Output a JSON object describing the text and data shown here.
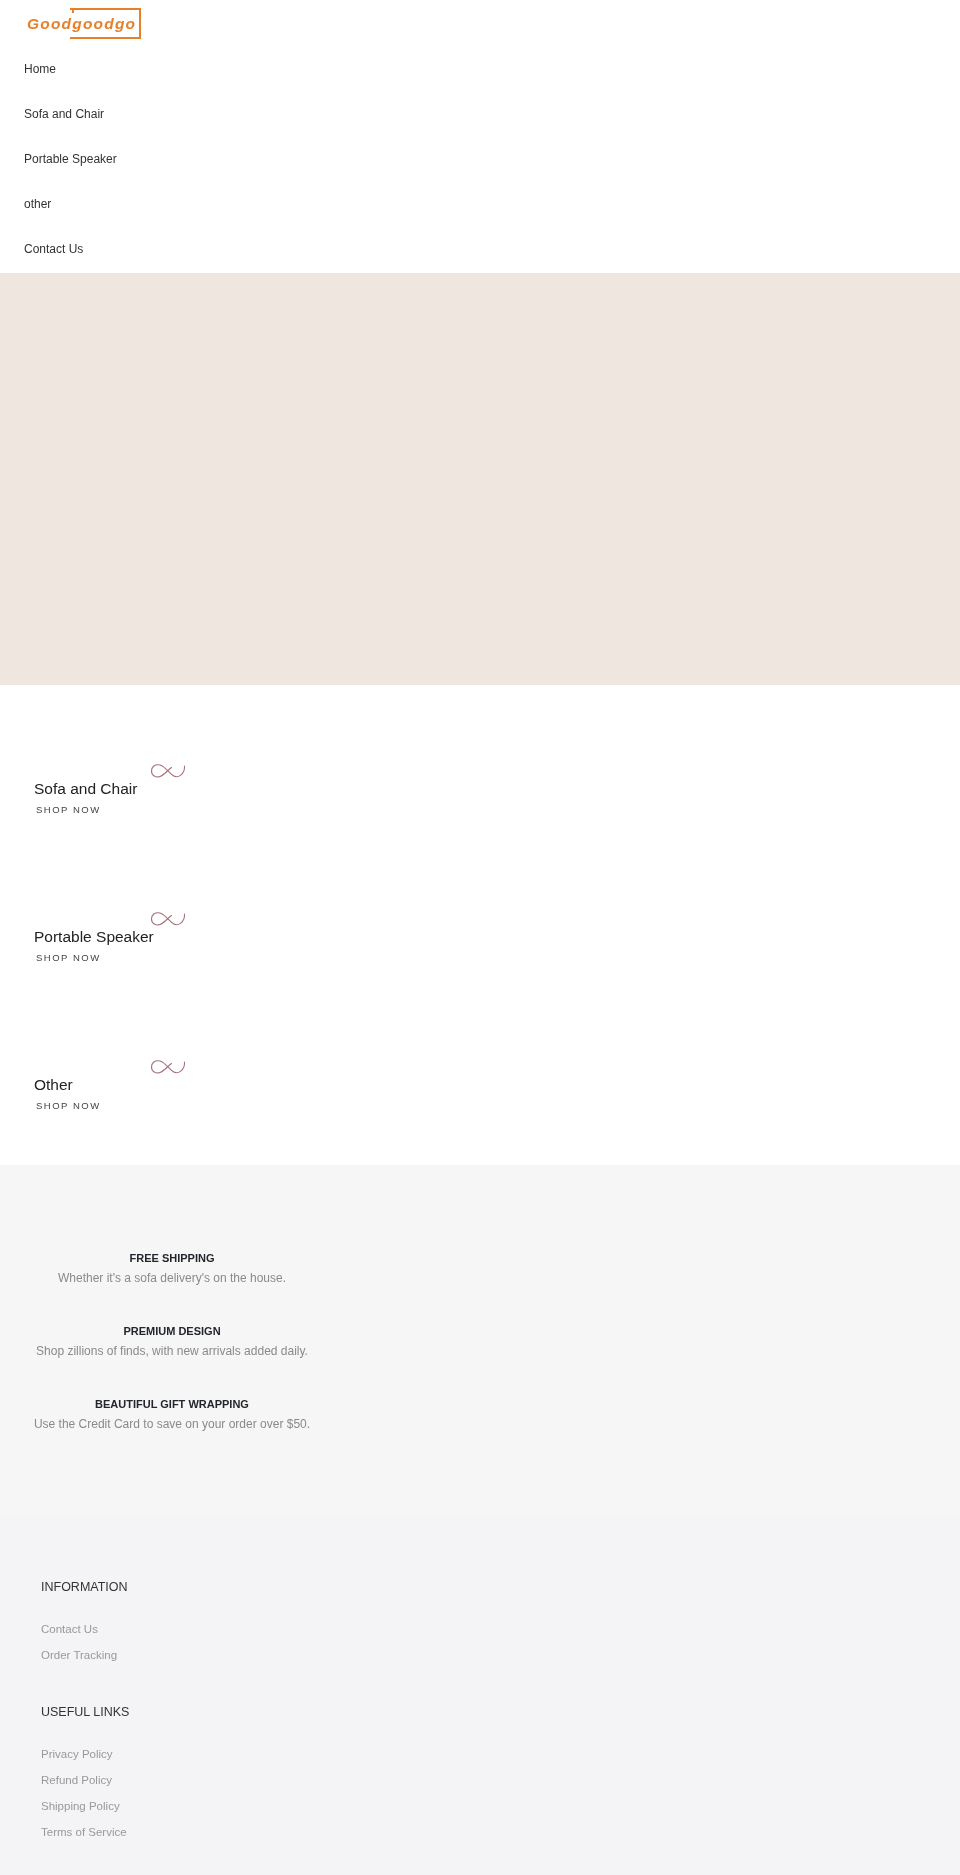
{
  "header": {
    "logo": "Goodgoodgo",
    "nav": [
      "Home",
      "Sofa and Chair",
      "Portable Speaker",
      "other",
      "Contact Us"
    ]
  },
  "categories": [
    {
      "title": "Sofa and Chair",
      "link": "SHOP NOW"
    },
    {
      "title": "Portable Speaker",
      "link": "SHOP NOW"
    },
    {
      "title": "Other",
      "link": "SHOP NOW"
    }
  ],
  "features": [
    {
      "title": "FREE SHIPPING",
      "text": "Whether it's a sofa delivery's on the house."
    },
    {
      "title": "PREMIUM DESIGN",
      "text": "Shop zillions of finds, with new arrivals added daily."
    },
    {
      "title": "BEAUTIFUL GIFT WRAPPING",
      "text": "Use the Credit Card to save on your order over $50."
    }
  ],
  "footer": {
    "sections": [
      {
        "title": "INFORMATION",
        "links": [
          "Contact Us",
          "Order Tracking"
        ]
      },
      {
        "title": "USEFUL LINKS",
        "links": [
          "Privacy Policy",
          "Refund Policy",
          "Shipping Policy",
          "Terms of Service"
        ]
      }
    ]
  }
}
